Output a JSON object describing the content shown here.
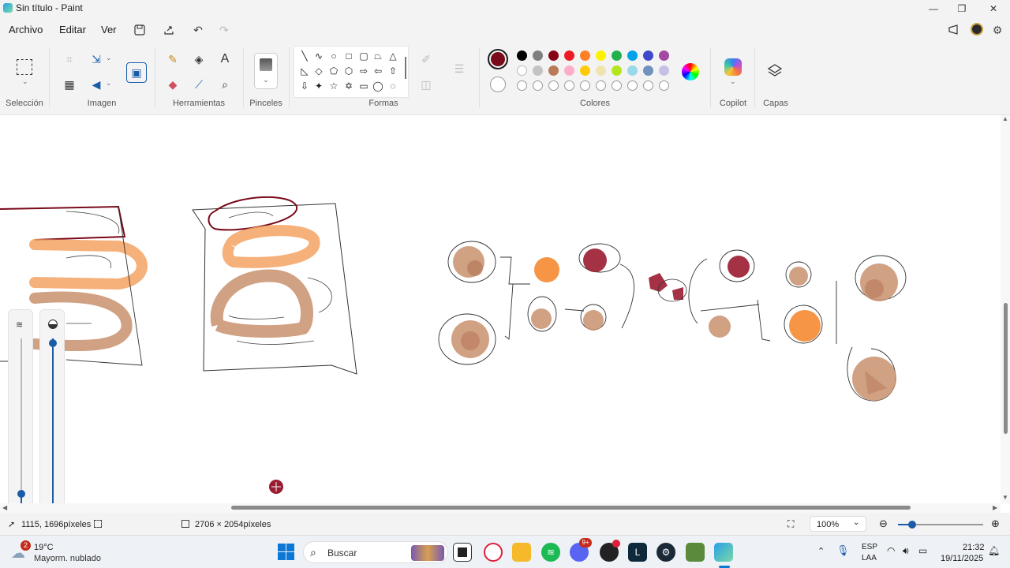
{
  "window": {
    "title": "Sin título - Paint"
  },
  "menu": {
    "file": "Archivo",
    "edit": "Editar",
    "view": "Ver"
  },
  "ribbon": {
    "groups": {
      "selection": "Selección",
      "image": "Imagen",
      "tools": "Herramientas",
      "brushes": "Pinceles",
      "shapes": "Formas",
      "colors": "Colores",
      "copilot": "Copilot",
      "layers": "Capas"
    }
  },
  "colors": {
    "active_primary": "#7a0a1a",
    "palette_row1": [
      "#000000",
      "#7f7f7f",
      "#880015",
      "#ed1c24",
      "#ff7f27",
      "#fff200",
      "#22b14c",
      "#00a2e8",
      "#3f48cc",
      "#a349a4"
    ],
    "palette_row2": [
      "#ffffff",
      "#c3c3c3",
      "#b97a57",
      "#ffaec9",
      "#ffc90e",
      "#efe4b0",
      "#b5e61d",
      "#99d9ea",
      "#7092be",
      "#c8bfe7"
    ]
  },
  "status": {
    "cursor_position": "1115, 1696píxeles",
    "canvas_size": "2706 × 2054píxeles",
    "zoom": "100%"
  },
  "taskbar": {
    "weather_badge": "2",
    "weather_temp": "19°C",
    "weather_desc": "Mayorm. nublado",
    "search_label": "Buscar",
    "discord_badge": "9+",
    "lang_line1": "ESP",
    "lang_line2": "LAA",
    "time": "21:32",
    "date": "19/11/2025"
  }
}
